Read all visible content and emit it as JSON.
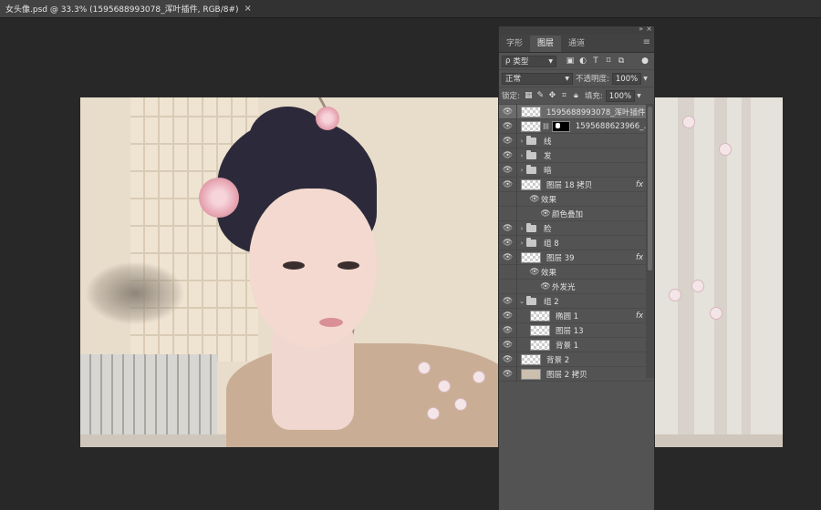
{
  "document_tab": {
    "title": "女头像.psd @ 33.3% (1595688993078_浑叶插件, RGB/8#)",
    "close_glyph": "×"
  },
  "layers_panel": {
    "collapse_glyph": "»",
    "close_glyph": "×",
    "menu_glyph": "≡",
    "tabs": [
      {
        "label": "字形",
        "active": false
      },
      {
        "label": "图层",
        "active": true
      },
      {
        "label": "通道",
        "active": false
      }
    ],
    "filter": {
      "search_glyph": "ρ",
      "kind_label": "类型"
    },
    "blend_mode": "正常",
    "opacity_label": "不透明度:",
    "opacity_value": "100%",
    "lock_label": "锁定:",
    "fill_label": "填充:",
    "fill_value": "100%",
    "layers": [
      {
        "name": "1595688993078_浑叶插件",
        "type": "layer",
        "selected": true
      },
      {
        "name": "1595688623966_...",
        "type": "masked"
      },
      {
        "name": "线",
        "type": "group"
      },
      {
        "name": "发",
        "type": "group"
      },
      {
        "name": "暗",
        "type": "group"
      },
      {
        "name": "图层 18 拷贝",
        "type": "layer",
        "fx": true
      },
      {
        "name": "效果",
        "type": "effects"
      },
      {
        "name": "颜色叠加",
        "type": "effect"
      },
      {
        "name": "脸",
        "type": "group"
      },
      {
        "name": "组 8",
        "type": "group"
      },
      {
        "name": "图层 39",
        "type": "layer",
        "fx": true
      },
      {
        "name": "效果",
        "type": "effects"
      },
      {
        "name": "外发光",
        "type": "effect"
      },
      {
        "name": "组 2",
        "type": "group-open"
      },
      {
        "name": "椭圆 1",
        "type": "layer-child",
        "fx": true
      },
      {
        "name": "图层 13",
        "type": "layer-child"
      },
      {
        "name": "背景 1",
        "type": "layer-child"
      },
      {
        "name": "背景 2",
        "type": "layer"
      },
      {
        "name": "图层 2 拷贝",
        "type": "layer"
      }
    ],
    "fx_label": "fx"
  }
}
